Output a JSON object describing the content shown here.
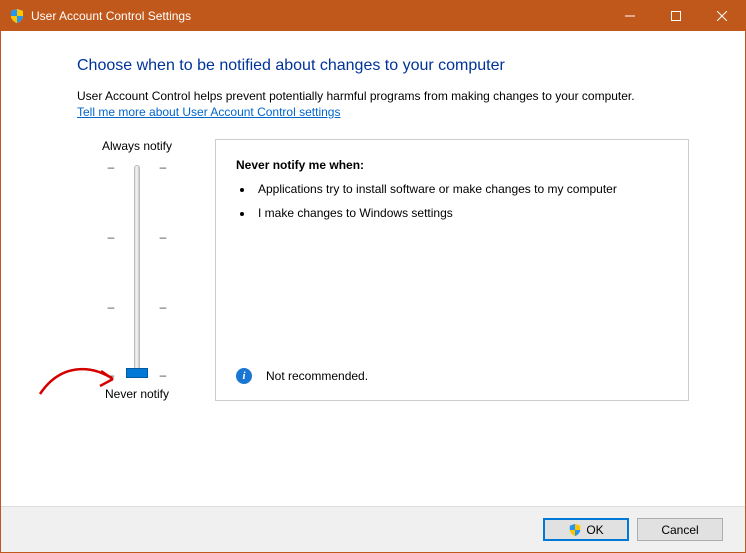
{
  "window": {
    "title": "User Account Control Settings"
  },
  "heading": "Choose when to be notified about changes to your computer",
  "subtext": "User Account Control helps prevent potentially harmful programs from making changes to your computer.",
  "link": "Tell me more about User Account Control settings",
  "slider": {
    "top_label": "Always notify",
    "bottom_label": "Never notify"
  },
  "description": {
    "title": "Never notify me when:",
    "bullets": [
      "Applications try to install software or make changes to my computer",
      "I make changes to Windows settings"
    ],
    "status": "Not recommended."
  },
  "buttons": {
    "ok": "OK",
    "cancel": "Cancel"
  }
}
